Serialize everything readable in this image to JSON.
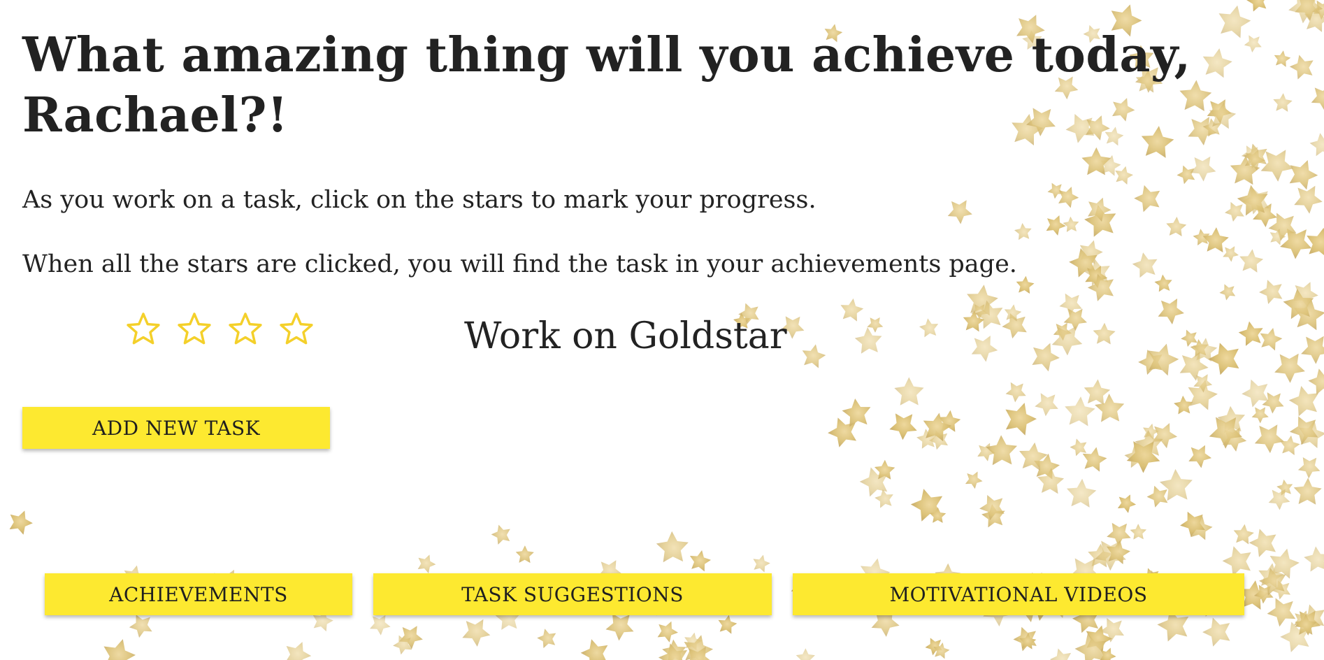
{
  "header": {
    "headline": "What amazing thing will you achieve today, Rachael?!"
  },
  "instructions": {
    "line1": "As you work on a task, click on the stars to mark your progress.",
    "line2": "When all the stars are clicked, you will find the task in your achievements page."
  },
  "task": {
    "title": "Work on Goldstar",
    "stars_total": 4,
    "stars_filled": 0,
    "star_icon": "star-outline-icon"
  },
  "actions": {
    "add_task_label": "ADD NEW TASK"
  },
  "nav": {
    "achievements_label": "ACHIEVEMENTS",
    "suggestions_label": "TASK SUGGESTIONS",
    "videos_label": "MOTIVATIONAL VIDEOS"
  },
  "colors": {
    "button_yellow": "#fde930",
    "star_outline": "#f4d02a",
    "confetti_gold": "#d6b85a",
    "text": "#222222"
  }
}
